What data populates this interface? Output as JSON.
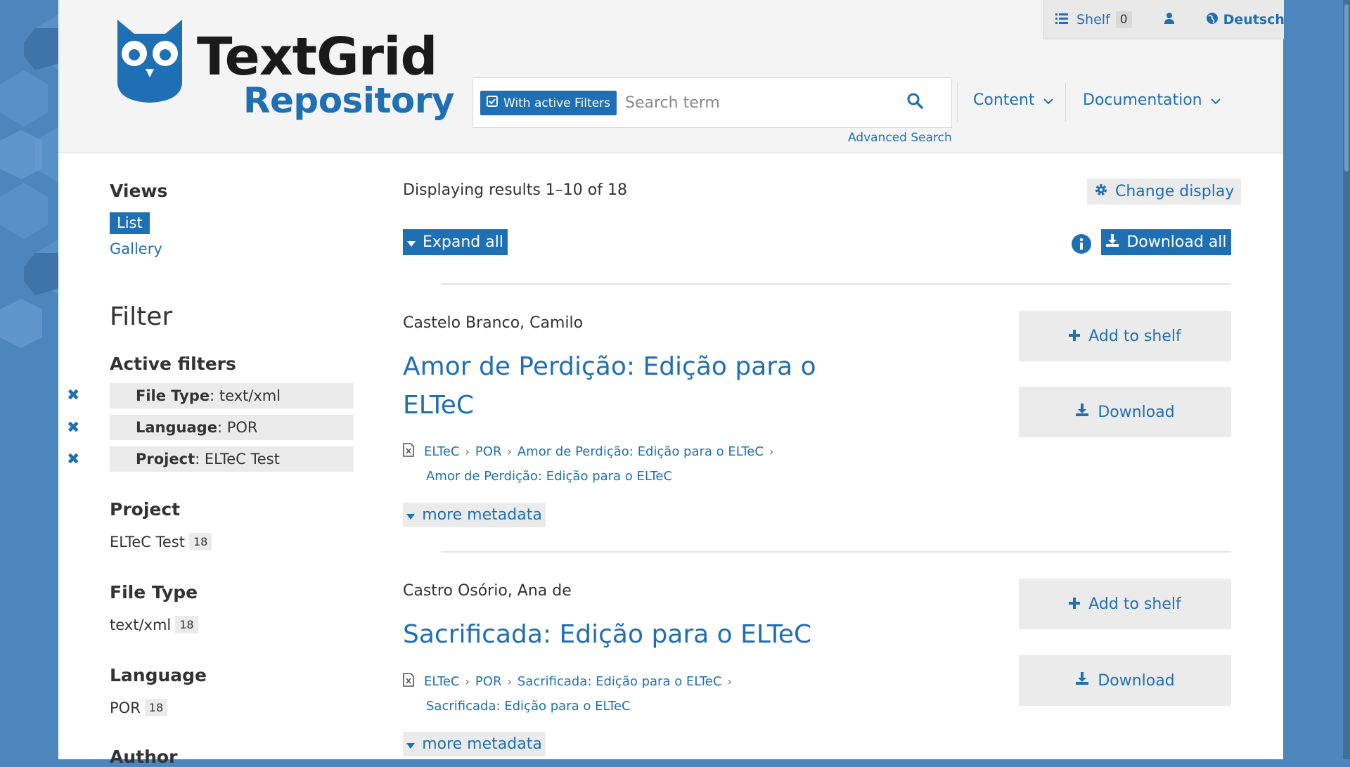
{
  "site": {
    "logo_title": "TextGrid",
    "logo_subtitle": "Repository",
    "brand_color": "#1f6fb4"
  },
  "topbar": {
    "shelf_label": "Shelf",
    "shelf_count": "0",
    "language_label": "Deutsch"
  },
  "search": {
    "filter_button": "With active Filters",
    "placeholder": "Search term",
    "advanced": "Advanced Search"
  },
  "nav": {
    "content": "Content",
    "documentation": "Documentation"
  },
  "sidebar": {
    "views_heading": "Views",
    "views": [
      "List",
      "Gallery"
    ],
    "filter_heading": "Filter",
    "active_filters_heading": "Active filters",
    "active_filters": [
      {
        "key": "File Type",
        "value": ": text/xml"
      },
      {
        "key": "Language",
        "value": ": POR"
      },
      {
        "key": "Project",
        "value": ": ELTeC Test"
      }
    ],
    "facets": [
      {
        "heading": "Project",
        "value": "ELTeC Test",
        "count": "18"
      },
      {
        "heading": "File Type",
        "value": "text/xml",
        "count": "18"
      },
      {
        "heading": "Language",
        "value": "POR",
        "count": "18"
      },
      {
        "heading": "Author"
      }
    ]
  },
  "results": {
    "summary": "Displaying results 1–10 of 18",
    "change_display": "Change display",
    "expand_all": "Expand all",
    "download_all": "Download all",
    "items": [
      {
        "author": "Castelo Branco, Camilo",
        "title": "Amor de Perdição: Edição para o ELTeC",
        "path": [
          "ELTeC",
          "POR",
          "Amor de Perdição: Edição para o ELTeC"
        ],
        "path_last": "Amor de Perdição: Edição para o ELTeC",
        "more": "more metadata",
        "add_to_shelf": "Add to shelf",
        "download": "Download"
      },
      {
        "author": "Castro Osório, Ana de",
        "title": "Sacrificada: Edição para o ELTeC",
        "path": [
          "ELTeC",
          "POR",
          "Sacrificada: Edição para o ELTeC"
        ],
        "path_last": "Sacrificada: Edição para o ELTeC",
        "more": "more metadata",
        "add_to_shelf": "Add to shelf",
        "download": "Download"
      }
    ]
  }
}
